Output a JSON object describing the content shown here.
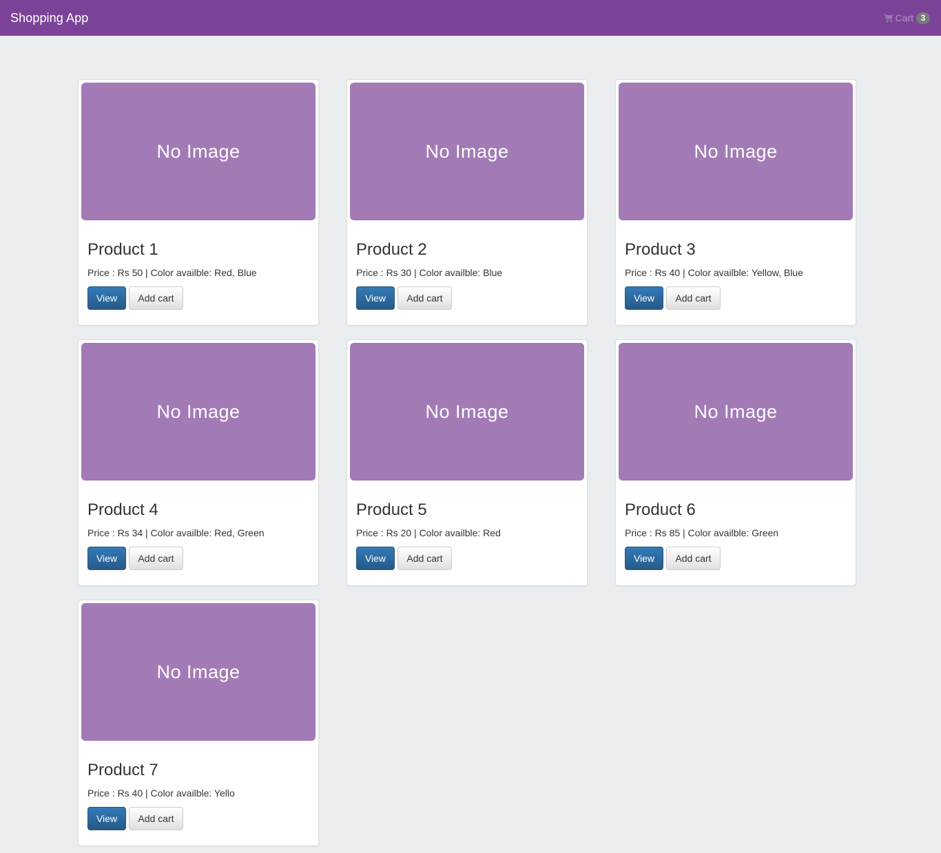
{
  "navbar": {
    "brand": "Shopping App",
    "cart_label": "Cart",
    "cart_count": "3",
    "cart_icon": "shopping-cart-icon",
    "bg_color": "#7b4397"
  },
  "buttons": {
    "view_label": "View",
    "add_cart_label": "Add cart"
  },
  "placeholder_text": "No Image",
  "products": [
    {
      "title": "Product 1",
      "desc": "Price : Rs 50 | Color availble: Red, Blue"
    },
    {
      "title": "Product 2",
      "desc": "Price : Rs 30 | Color availble: Blue"
    },
    {
      "title": "Product 3",
      "desc": "Price : Rs 40 | Color availble: Yellow, Blue"
    },
    {
      "title": "Product 4",
      "desc": "Price : Rs 34 | Color availble: Red, Green"
    },
    {
      "title": "Product 5",
      "desc": "Price : Rs 20 | Color availble: Red"
    },
    {
      "title": "Product 6",
      "desc": "Price : Rs 85 | Color availble: Green"
    },
    {
      "title": "Product 7",
      "desc": "Price : Rs 40 | Color availble: Yello"
    }
  ]
}
